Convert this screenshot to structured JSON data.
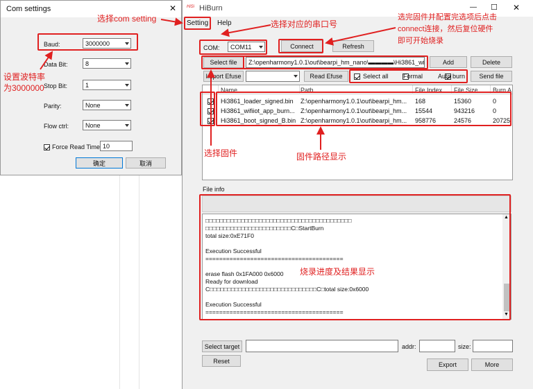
{
  "com_settings": {
    "title": "Com settings",
    "close": "✕",
    "fields": [
      {
        "label": "Baud:",
        "value": "3000000"
      },
      {
        "label": "Data Bit:",
        "value": "8"
      },
      {
        "label": "Stop Bit:",
        "value": "1"
      },
      {
        "label": "Parity:",
        "value": "None"
      },
      {
        "label": "Flow ctrl:",
        "value": "None"
      }
    ],
    "force_read_label": "Force Read Time",
    "force_read_value": "10",
    "ok_label": "确定",
    "cancel_label": "取消"
  },
  "hiburn": {
    "title": "HiBurn",
    "logo": "HiSi",
    "window_controls": {
      "minimize": "—",
      "maximize": "☐",
      "close": "✕"
    },
    "menu": [
      "Setting",
      "Help"
    ],
    "com_label": "COM:",
    "com_value": "COM11",
    "connect_label": "Connect",
    "refresh_label": "Refresh",
    "select_file_label": "Select file",
    "file_path_value": "Z:\\openharmony1.0.1\\out\\bearpi_hm_nano\\▬▬▬▬\\Hi3861_wi",
    "add_label": "Add",
    "delete_label": "Delete",
    "import_efuse_label": "Import Efuse",
    "read_efuse_label": "Read Efuse",
    "select_all_label": "Select all",
    "formal_label": "Formal",
    "auto_burn_label": "Auto burn",
    "send_file_label": "Send file",
    "table_headers": [
      "Name",
      "Path",
      "File Index",
      "File Size",
      "Burn A"
    ],
    "files": [
      {
        "name": "Hi3861_loader_signed.bin",
        "path": "Z:\\openharmony1.0.1\\out\\bearpi_hm...",
        "index": "168",
        "size": "15360",
        "burn": "0"
      },
      {
        "name": "Hi3861_wifiiot_app_burn...",
        "path": "Z:\\openharmony1.0.1\\out\\bearpi_hm...",
        "index": "15544",
        "size": "943216",
        "burn": "0"
      },
      {
        "name": "Hi3861_boot_signed_B.bin",
        "path": "Z:\\openharmony1.0.1\\out\\bearpi_hm...",
        "index": "958776",
        "size": "24576",
        "burn": "20725"
      }
    ],
    "file_info_label": "File info",
    "log_lines": [
      "□□□□□□□□□□□□□□□□□□□□□□□□□□□□□□□□□□□□□□□□□",
      "□□□□□□□□□□□□□□□□□□□□□□□□C□StartBurn",
      "total size:0xE71F0",
      "",
      "Execution Successful",
      "========================================",
      "",
      "erase flash 0x1FA000 0x6000",
      "Ready for download",
      "C□□□□□□□□□□□□□□□□□□□□□□□□□□□□□□C□total size:0x6000",
      "",
      "Execution Successful",
      "========================================"
    ],
    "select_target_label": "Select target",
    "addr_label": "addr:",
    "size_label": "size:",
    "reset_label": "Reset",
    "export_label": "Export",
    "more_label": "More"
  },
  "annotations": {
    "choose_setting": "选择com setting",
    "choose_port": "选择对应的串口号",
    "connect_hint_1": "选完固件并配置完选项后点击",
    "connect_hint_2": "connect连接，然后复位硬件",
    "connect_hint_3": "即可开始烧录",
    "baud_hint_1": "设置波特率",
    "baud_hint_2": "为3000000",
    "select_firmware": "选择固件",
    "firmware_path": "固件路径显示",
    "progress_result": "烧录进度及结果显示"
  },
  "colors": {
    "annotation": "#e02020",
    "selection": "#0078d7",
    "button": "#e1e1e1",
    "panel": "#f0f0f0"
  }
}
